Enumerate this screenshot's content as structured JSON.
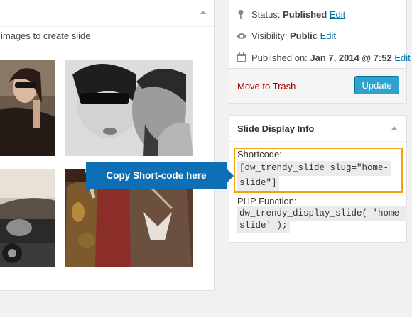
{
  "slide_images": {
    "instructions": "images to create slide"
  },
  "publish": {
    "status_label": "Status:",
    "status_value": "Published",
    "visibility_label": "Visibility:",
    "visibility_value": "Public",
    "published_label": "Published on:",
    "published_value": "Jan 7, 2014 @ 7:52",
    "edit_label": "Edit",
    "trash_label": "Move to Trash",
    "update_label": "Update"
  },
  "slide_display_info": {
    "title": "Slide Display Info",
    "shortcode_label": "Shortcode:",
    "shortcode_line1": "[dw_trendy_slide slug=\"home-",
    "shortcode_line2": "slide\"]",
    "php_label": "PHP Function:",
    "php_line1": "dw_trendy_display_slide( 'home-",
    "php_line2": "slide' );"
  },
  "callout": {
    "text": "Copy Short-code here"
  },
  "colors": {
    "link": "#0073aa",
    "trash": "#aa0000",
    "update_button": "#2ea2cc",
    "callout": "#0e6fb5",
    "highlight_frame": "#f0a30a"
  },
  "icons": [
    "pin-icon",
    "eye-icon",
    "calendar-icon",
    "collapse-caret-icon"
  ]
}
